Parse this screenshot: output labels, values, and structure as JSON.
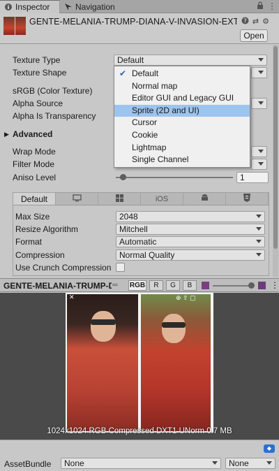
{
  "tabs": [
    {
      "label": "Inspector",
      "icon": "info-icon",
      "active": true
    },
    {
      "label": "Navigation",
      "icon": "navigation-icon",
      "active": false
    }
  ],
  "header": {
    "title": "GENTE-MELANIA-TRUMP-DIANA-V-INVASION-EXTI",
    "open_label": "Open"
  },
  "properties": {
    "texture_type_label": "Texture Type",
    "texture_type_value": "Default",
    "texture_shape_label": "Texture Shape",
    "srgb_label": "sRGB (Color Texture)",
    "alpha_source_label": "Alpha Source",
    "alpha_transparency_label": "Alpha Is Transparency",
    "advanced_label": "Advanced",
    "wrap_mode_label": "Wrap Mode",
    "filter_mode_label": "Filter Mode",
    "aniso_label": "Aniso Level",
    "aniso_value": "1"
  },
  "popup": {
    "items": [
      "Default",
      "Normal map",
      "Editor GUI and Legacy GUI",
      "Sprite (2D and UI)",
      "Cursor",
      "Cookie",
      "Lightmap",
      "Single Channel"
    ],
    "checked_index": 0,
    "highlighted_index": 3
  },
  "platform": {
    "tabs": [
      "Default",
      "",
      "",
      "iOS",
      "",
      ""
    ],
    "max_size_label": "Max Size",
    "max_size_value": "2048",
    "resize_label": "Resize Algorithm",
    "resize_value": "Mitchell",
    "format_label": "Format",
    "format_value": "Automatic",
    "compression_label": "Compression",
    "compression_value": "Normal Quality",
    "crunch_label": "Use Crunch Compression"
  },
  "preview": {
    "name": "GENTE-MELANIA-TRUMP-D",
    "channels": [
      "RGB",
      "R",
      "G",
      "B"
    ],
    "info": "1024x1024  RGB Compressed DXT1 UNorm  0.7 MB"
  },
  "asset_bundle": {
    "label": "AssetBundle",
    "bundle_value": "None",
    "variant_value": "None"
  },
  "colors": {
    "highlight": "#9cc4ee",
    "check": "#2d63b0",
    "tag": "#2d6fd1"
  }
}
